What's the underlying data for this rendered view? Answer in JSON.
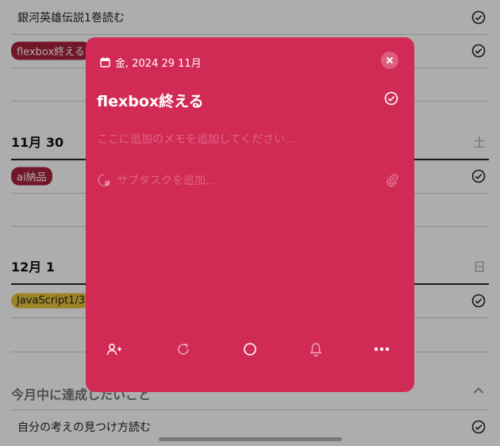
{
  "list": {
    "rows": [
      {
        "text": "銀河英雄伝説1巻読む"
      },
      {
        "tag": "flexbox終える"
      },
      {
        "tag": "ai納品"
      },
      {
        "tag": "JavaScript1/3"
      },
      {
        "text": "自分の考えの見つけ方読む"
      }
    ],
    "days": [
      {
        "label": "11月 30",
        "weekday": "土"
      },
      {
        "label": "12月 1",
        "weekday": "日"
      }
    ],
    "section": {
      "label": "今月中に達成したいこと"
    }
  },
  "modal": {
    "date": "金, 2024 29 11月",
    "title": "flexbox終える",
    "memo_placeholder": "ここに追加のメモを追加してください...",
    "subtask_placeholder": "サブタスクを追加...",
    "background_color": "#d12a54"
  },
  "icons": [
    "calendar-icon",
    "close-icon",
    "check-circle-icon",
    "subtask-icon",
    "paperclip-icon",
    "add-person-icon",
    "repeat-icon",
    "circle-icon",
    "bell-icon",
    "more-icon",
    "chevron-up-icon"
  ]
}
